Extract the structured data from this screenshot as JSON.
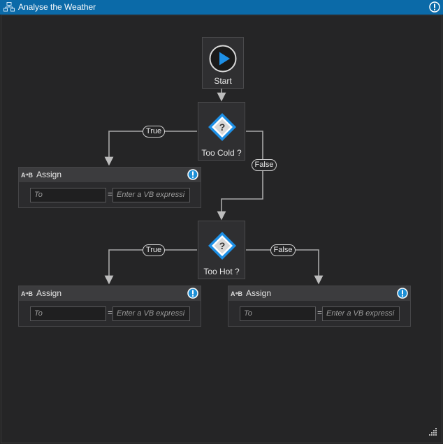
{
  "window": {
    "title": "Analyse the Weather"
  },
  "start": {
    "label": "Start"
  },
  "decisions": [
    {
      "label": "Too Cold ?",
      "true_label": "True",
      "false_label": "False"
    },
    {
      "label": "Too Hot ?",
      "true_label": "True",
      "false_label": "False"
    }
  ],
  "assigns": [
    {
      "title": "Assign",
      "to_placeholder": "To",
      "equals": "=",
      "value_placeholder": "Enter a VB expressi"
    },
    {
      "title": "Assign",
      "to_placeholder": "To",
      "equals": "=",
      "value_placeholder": "Enter a VB expressi"
    },
    {
      "title": "Assign",
      "to_placeholder": "To",
      "equals": "=",
      "value_placeholder": "Enter a VB expressi"
    }
  ],
  "colors": {
    "accent": "#0b6aa8",
    "play": "#1e90e6",
    "warning": "#1c8fd6",
    "canvas": "#252526"
  }
}
